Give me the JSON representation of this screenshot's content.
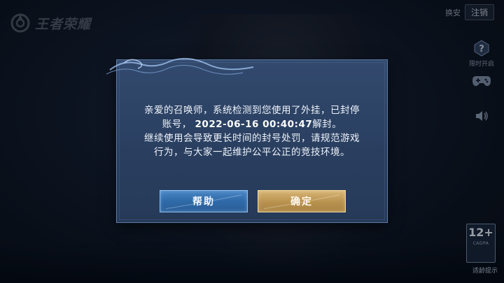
{
  "app": {
    "logo_text": "王者荣耀"
  },
  "top_right": {
    "switch_label": "换安",
    "logout_label": "注销"
  },
  "side": {
    "help_label": "限时开启"
  },
  "age_rating": {
    "rating": "12+",
    "cadpa": "CADPA",
    "tip": "适龄提示"
  },
  "dialog": {
    "line1": "亲爱的召唤师，系统检测到您使用了外挂，已封停",
    "line2_prefix": "账号，",
    "unban_time": "2022-06-16 00:40:47",
    "line2_suffix": "解封。",
    "line3": "继续使用会导致更长时间的封号处罚，请规范游戏",
    "line4": "行为，与大家一起维护公平公正的竞技环境。",
    "help_button": "帮助",
    "ok_button": "确定"
  },
  "colors": {
    "dialog_bg": "#2c4365",
    "help_button": "#3a76b6",
    "ok_button": "#c09a55"
  }
}
